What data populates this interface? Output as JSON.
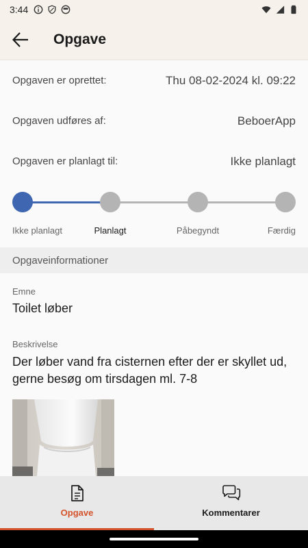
{
  "status_bar": {
    "time": "3:44",
    "left_icons": [
      "info-icon",
      "shield-icon",
      "face-icon"
    ],
    "right_icons": [
      "wifi-icon",
      "signal-icon",
      "battery-icon"
    ]
  },
  "app_bar": {
    "back_icon": "arrow-left-icon",
    "title": "Opgave"
  },
  "details": [
    {
      "label": "Opgaven er oprettet:",
      "value": "Thu 08-02-2024 kl. 09:22"
    },
    {
      "label": "Opgaven udføres af:",
      "value": "BeboerApp"
    },
    {
      "label": "Opgaven er planlagt til:",
      "value": "Ikke planlagt"
    }
  ],
  "progress": {
    "steps": [
      "Ikke planlagt",
      "Planlagt",
      "Påbegyndt",
      "Færdig"
    ],
    "current_step_index": 0,
    "active_color": "#3f66b0",
    "inactive_color": "#b4b4b4"
  },
  "info_section": {
    "header": "Opgaveinformationer",
    "subject_label": "Emne",
    "subject_value": "Toilet løber",
    "description_label": "Beskrivelse",
    "description_line1": "Der løber vand fra cisternen efter der er skyllet ud,",
    "description_line2": "gerne besøg om tirsdagen ml. 7-8"
  },
  "bottom_nav": {
    "accent_color": "#d4522a",
    "items": [
      {
        "label": "Opgave",
        "icon": "document-icon",
        "active": true
      },
      {
        "label": "Kommentarer",
        "icon": "chat-bubbles-icon",
        "active": false
      }
    ]
  }
}
